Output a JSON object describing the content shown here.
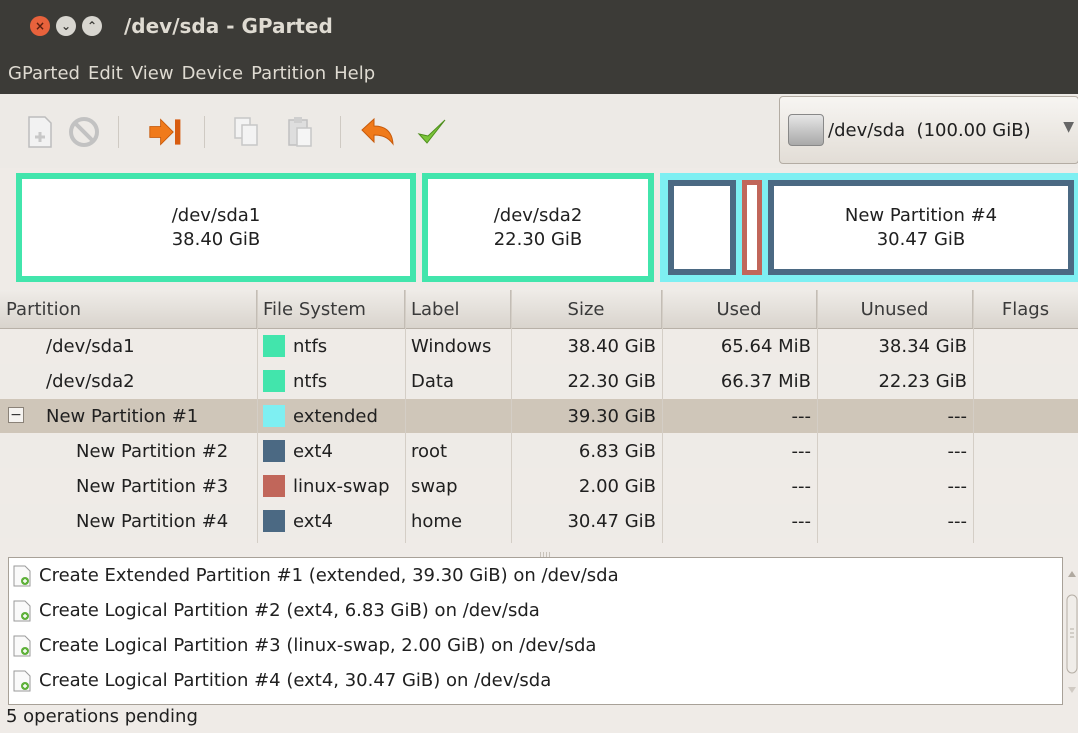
{
  "window": {
    "title": "/dev/sda - GParted"
  },
  "menu": [
    "GParted",
    "Edit",
    "View",
    "Device",
    "Partition",
    "Help"
  ],
  "toolbar": {
    "buttons": [
      "new-partition",
      "delete-partition",
      "resize-move",
      "copy",
      "paste",
      "undo",
      "apply"
    ]
  },
  "device": {
    "label": "/dev/sda  (100.00 GiB)",
    "arrow": "▼"
  },
  "map": {
    "sda1": {
      "name": "/dev/sda1",
      "size": "38.40 GiB"
    },
    "sda2": {
      "name": "/dev/sda2",
      "size": "22.30 GiB"
    },
    "p4": {
      "name": "New Partition #4",
      "size": "30.47 GiB"
    }
  },
  "columns": [
    "Partition",
    "File System",
    "Label",
    "Size",
    "Used",
    "Unused",
    "Flags"
  ],
  "rows": [
    {
      "partition": "/dev/sda1",
      "fs": "ntfs",
      "color": "#42e5ac",
      "label": "Windows",
      "size": "38.40 GiB",
      "used": "65.64 MiB",
      "unused": "38.34 GiB",
      "flags": ""
    },
    {
      "partition": "/dev/sda2",
      "fs": "ntfs",
      "color": "#42e5ac",
      "label": "Data",
      "size": "22.30 GiB",
      "used": "66.37 MiB",
      "unused": "22.23 GiB",
      "flags": ""
    },
    {
      "partition": "New Partition #1",
      "fs": "extended",
      "color": "#7eeff2",
      "label": "",
      "size": "39.30 GiB",
      "used": "---",
      "unused": "---",
      "flags": ""
    },
    {
      "partition": "New Partition #2",
      "fs": "ext4",
      "color": "#4b6983",
      "label": "root",
      "size": "6.83 GiB",
      "used": "---",
      "unused": "---",
      "flags": ""
    },
    {
      "partition": "New Partition #3",
      "fs": "linux-swap",
      "color": "#c1665a",
      "label": "swap",
      "size": "2.00 GiB",
      "used": "---",
      "unused": "---",
      "flags": ""
    },
    {
      "partition": "New Partition #4",
      "fs": "ext4",
      "color": "#4b6983",
      "label": "home",
      "size": "30.47 GiB",
      "used": "---",
      "unused": "---",
      "flags": ""
    }
  ],
  "expander": "−",
  "operations": [
    "Create Extended Partition #1 (extended, 39.30 GiB) on /dev/sda",
    "Create Logical Partition #2 (ext4, 6.83 GiB) on /dev/sda",
    "Create Logical Partition #3 (linux-swap, 2.00 GiB) on /dev/sda",
    "Create Logical Partition #4 (ext4, 30.47 GiB) on /dev/sda"
  ],
  "status": "5 operations pending"
}
